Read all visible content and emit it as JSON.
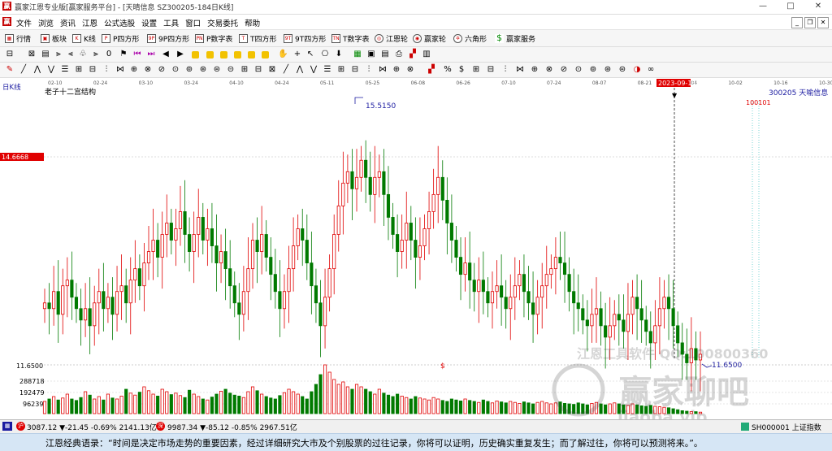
{
  "window": {
    "title": "赢家江恩专业版[赢家服务平台] - [天晴信息  SZ300205-184日K线]",
    "min": "—",
    "max": "□",
    "close": "✕"
  },
  "menu": {
    "items": [
      "文件",
      "浏览",
      "资讯",
      "江恩",
      "公式选股",
      "设置",
      "工具",
      "窗口",
      "交易委托",
      "帮助"
    ]
  },
  "mdi": {
    "min": "_",
    "restore": "❐",
    "close": "✕"
  },
  "toolbar": {
    "items": [
      {
        "label": "行情",
        "icon": "quote-icon"
      },
      {
        "label": "板块",
        "icon": "sector-icon"
      },
      {
        "label": "K线",
        "icon": "kline-icon"
      },
      {
        "label": "P四方形",
        "icon": "p-square-icon"
      },
      {
        "label": "9P四方形",
        "icon": "9p-square-icon"
      },
      {
        "label": "P数字表",
        "icon": "p-table-icon"
      },
      {
        "label": "T四方形",
        "icon": "t-square-icon"
      },
      {
        "label": "9T四方形",
        "icon": "9t-square-icon"
      },
      {
        "label": "T数字表",
        "icon": "t-table-icon"
      },
      {
        "label": "江恩轮",
        "icon": "gann-wheel-icon"
      },
      {
        "label": "赢家轮",
        "icon": "winner-wheel-icon"
      },
      {
        "label": "六角形",
        "icon": "hexagon-icon"
      },
      {
        "label": "赢家服务",
        "icon": "dollar-icon"
      }
    ]
  },
  "chart": {
    "period_label": "日K线",
    "indicator_title": "老子十二宫结构",
    "stock_label": "300205  天喻信息",
    "current_price": "14.6668",
    "high_label": "15.5150",
    "low_label": "11.6500",
    "low_axis_label": "11.6500",
    "cursor_date": "2023-09-13",
    "marker_text": "100101",
    "dollar_marker": "$",
    "dates": [
      "02-10",
      "02-24",
      "03-10",
      "03-24",
      "04-10",
      "04-24",
      "05-11",
      "05-25",
      "06-08",
      "06-26",
      "07-10",
      "07-24",
      "08-07",
      "08-21",
      "09-04",
      "10-02",
      "10-16",
      "10-30"
    ],
    "volume_labels": [
      "288718",
      "192479",
      "96239"
    ]
  },
  "chart_data": {
    "type": "candlestick",
    "price_high": 15.515,
    "price_low": 11.65,
    "price_range_hint": [
      11.6,
      16.3
    ],
    "closes": [
      12.7,
      12.6,
      12.9,
      12.5,
      13.0,
      13.1,
      12.8,
      12.6,
      12.4,
      12.6,
      12.3,
      12.7,
      12.9,
      12.6,
      12.8,
      12.5,
      12.9,
      13.0,
      12.7,
      13.1,
      13.3,
      13.0,
      13.4,
      13.6,
      13.8,
      13.5,
      13.9,
      14.1,
      13.8,
      14.0,
      14.3,
      13.9,
      13.6,
      13.9,
      14.2,
      13.8,
      14.0,
      13.7,
      13.4,
      13.6,
      13.3,
      13.0,
      12.7,
      12.5,
      12.9,
      13.3,
      13.8,
      13.6,
      13.9,
      13.5,
      13.2,
      12.9,
      12.6,
      12.9,
      13.3,
      13.7,
      14.0,
      13.8,
      13.4,
      13.0,
      12.7,
      12.3,
      12.8,
      13.3,
      13.9,
      14.4,
      14.8,
      15.0,
      14.7,
      14.9,
      15.2,
      14.9,
      14.6,
      14.9,
      15.0,
      14.6,
      14.2,
      13.9,
      13.6,
      13.8,
      14.1,
      13.8,
      13.5,
      13.7,
      14.0,
      14.3,
      14.6,
      14.9,
      14.5,
      14.1,
      13.8,
      13.5,
      13.2,
      13.4,
      13.1,
      12.9,
      13.1,
      12.9,
      12.7,
      12.9,
      13.0,
      12.8,
      12.6,
      12.8,
      13.0,
      13.2,
      12.9,
      12.7,
      12.5,
      12.8,
      13.0,
      13.2,
      13.3,
      13.5,
      13.4,
      13.2,
      12.9,
      12.7,
      12.6,
      12.4,
      12.3,
      12.5,
      12.6,
      12.3,
      12.1,
      12.3,
      12.5,
      12.4,
      12.2,
      12.5,
      12.8,
      12.6,
      12.4,
      12.2,
      12.0,
      12.3,
      12.6,
      12.8,
      12.6,
      12.3,
      12.0,
      11.8,
      11.65,
      11.9,
      11.7,
      11.8
    ],
    "volumes": [
      0.25,
      0.3,
      0.35,
      0.28,
      0.32,
      0.4,
      0.3,
      0.27,
      0.33,
      0.45,
      0.38,
      0.3,
      0.35,
      0.28,
      0.4,
      0.32,
      0.3,
      0.36,
      0.5,
      0.42,
      0.38,
      0.44,
      0.55,
      0.47,
      0.4,
      0.36,
      0.5,
      0.45,
      0.39,
      0.42,
      0.37,
      0.33,
      0.48,
      0.4,
      0.35,
      0.3,
      0.28,
      0.34,
      0.4,
      0.46,
      0.5,
      0.42,
      0.38,
      0.36,
      0.33,
      0.45,
      0.55,
      0.47,
      0.4,
      0.35,
      0.32,
      0.3,
      0.37,
      0.43,
      0.5,
      0.45,
      0.4,
      0.35,
      0.3,
      0.45,
      0.6,
      0.8,
      1.0,
      0.85,
      0.7,
      0.6,
      0.65,
      0.55,
      0.5,
      0.6,
      0.55,
      0.5,
      0.45,
      0.4,
      0.5,
      0.42,
      0.38,
      0.35,
      0.4,
      0.36,
      0.33,
      0.3,
      0.35,
      0.32,
      0.3,
      0.28,
      0.33,
      0.3,
      0.27,
      0.25,
      0.3,
      0.28,
      0.26,
      0.3,
      0.27,
      0.25,
      0.23,
      0.28,
      0.25,
      0.22,
      0.26,
      0.24,
      0.22,
      0.25,
      0.23,
      0.21,
      0.24,
      0.22,
      0.2,
      0.23,
      0.25,
      0.22,
      0.2,
      0.22,
      0.24,
      0.21,
      0.2,
      0.19,
      0.22,
      0.2,
      0.18,
      0.21,
      0.23,
      0.2,
      0.18,
      0.2,
      0.22,
      0.2,
      0.18,
      0.17,
      0.2,
      0.18,
      0.16,
      0.15,
      0.17,
      0.15,
      0.14,
      0.13,
      0.12,
      0.1,
      0.08,
      0.06,
      0.05,
      0.04,
      0.04,
      0.03
    ]
  },
  "status": {
    "sh": "3087.12 ▼-21.45 -0.69% 2141.13亿",
    "sz": "9987.34 ▼-85.12 -0.85% 2967.51亿",
    "index": "SH000001 上证指数"
  },
  "quote": {
    "text": "江恩经典语录：“时间是决定市场走势的重要因素，经过详细研究大市及个别股票的过往记录，你将可以证明，历史确实重复发生；而了解过往，你将可以预测将来。”。"
  },
  "watermark": {
    "line1": "江恩工具软件  QQ:100800360",
    "line2": "赢家聊吧",
    "line3": "iiaoba.vip"
  },
  "colors": {
    "up": "#e00000",
    "down": "#007a00",
    "grid": "#d8d8d8",
    "accent": "#1a1aa0",
    "badge": "#e00000"
  }
}
